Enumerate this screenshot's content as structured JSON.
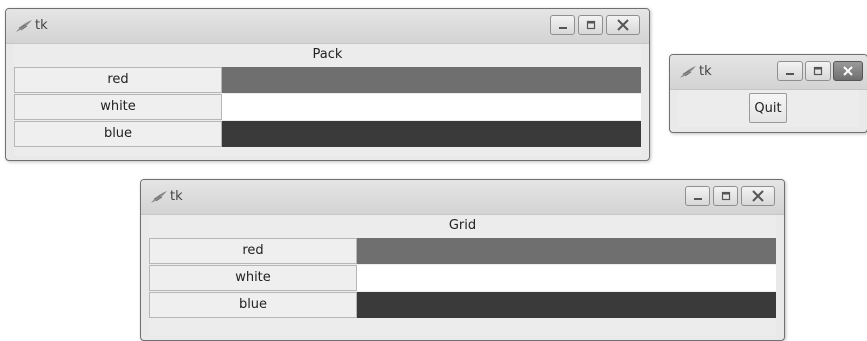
{
  "pack_window": {
    "title": "tk",
    "heading": "Pack",
    "rows": [
      {
        "label": "red",
        "color": "#6f6f6f"
      },
      {
        "label": "white",
        "color": "#ffffff"
      },
      {
        "label": "blue",
        "color": "#3a3a3a"
      }
    ]
  },
  "quit_window": {
    "title": "tk",
    "quit_label": "Quit"
  },
  "grid_window": {
    "title": "tk",
    "heading": "Grid",
    "rows": [
      {
        "label": "red",
        "color": "#6f6f6f"
      },
      {
        "label": "white",
        "color": "#ffffff"
      },
      {
        "label": "blue",
        "color": "#3a3a3a"
      }
    ]
  }
}
